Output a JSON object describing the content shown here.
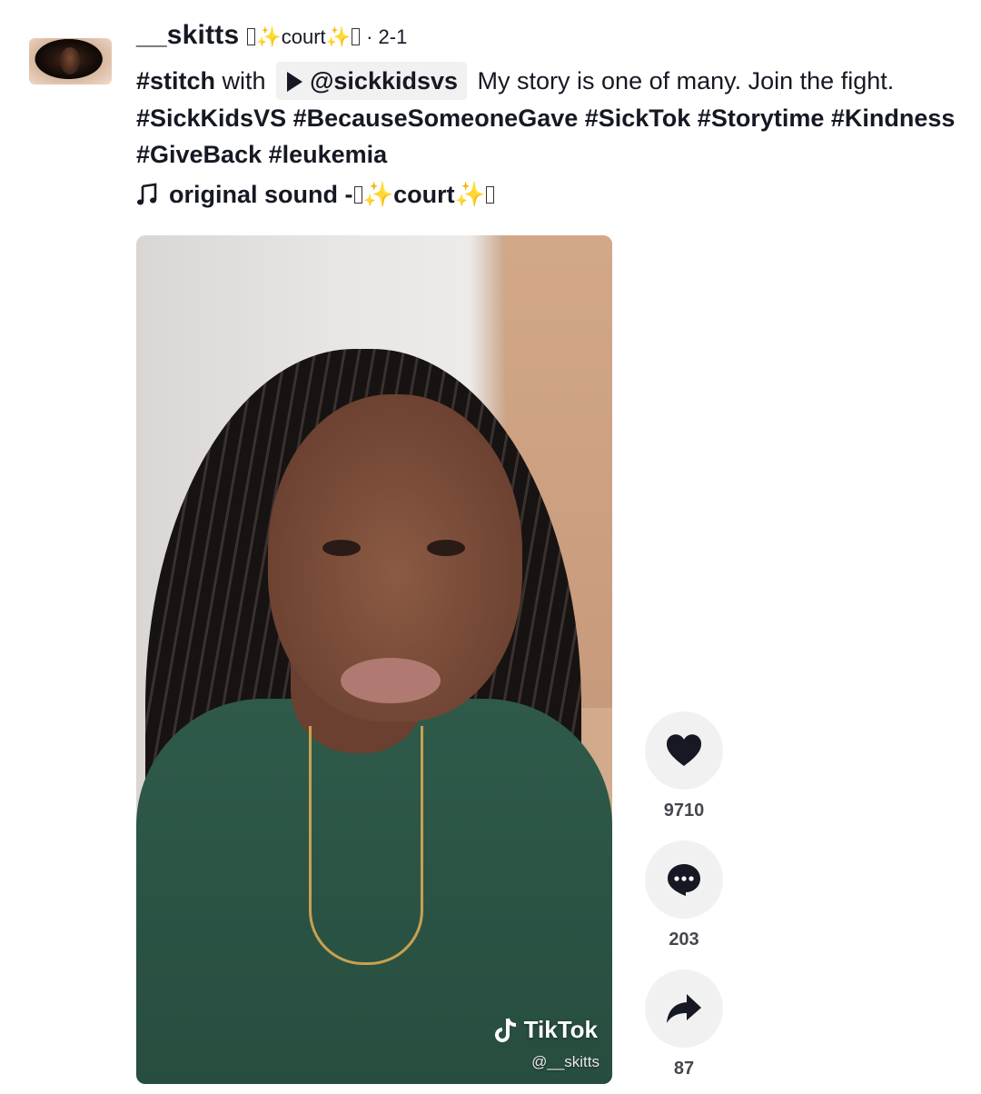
{
  "author": {
    "username": "__skitts",
    "nickname_text": "court",
    "date": "· 2-1"
  },
  "description": {
    "stitch_tag": "#stitch",
    "with_text": "with",
    "mention": "@sickkidsvs",
    "text": "My story is one of many. Join the fight.",
    "hashtags_line1": "#SickKidsVS #BecauseSomeoneGave #SickTok #Storytime #Kindness",
    "hashtags_line2": "#GiveBack #leukemia"
  },
  "sound": {
    "prefix": "original sound - ",
    "name": "court"
  },
  "video": {
    "watermark_brand": "TikTok",
    "watermark_handle": "@__skitts"
  },
  "actions": {
    "likes": "9710",
    "comments": "203",
    "shares": "87"
  },
  "icons": {
    "like": "heart-icon",
    "comment": "comment-bubble-icon",
    "share": "share-arrow-icon",
    "music": "music-note-icon",
    "play": "play-icon"
  },
  "colors": {
    "text": "#161823",
    "pill_bg": "#f1f1f2",
    "sparkle": "#f2c94c"
  }
}
